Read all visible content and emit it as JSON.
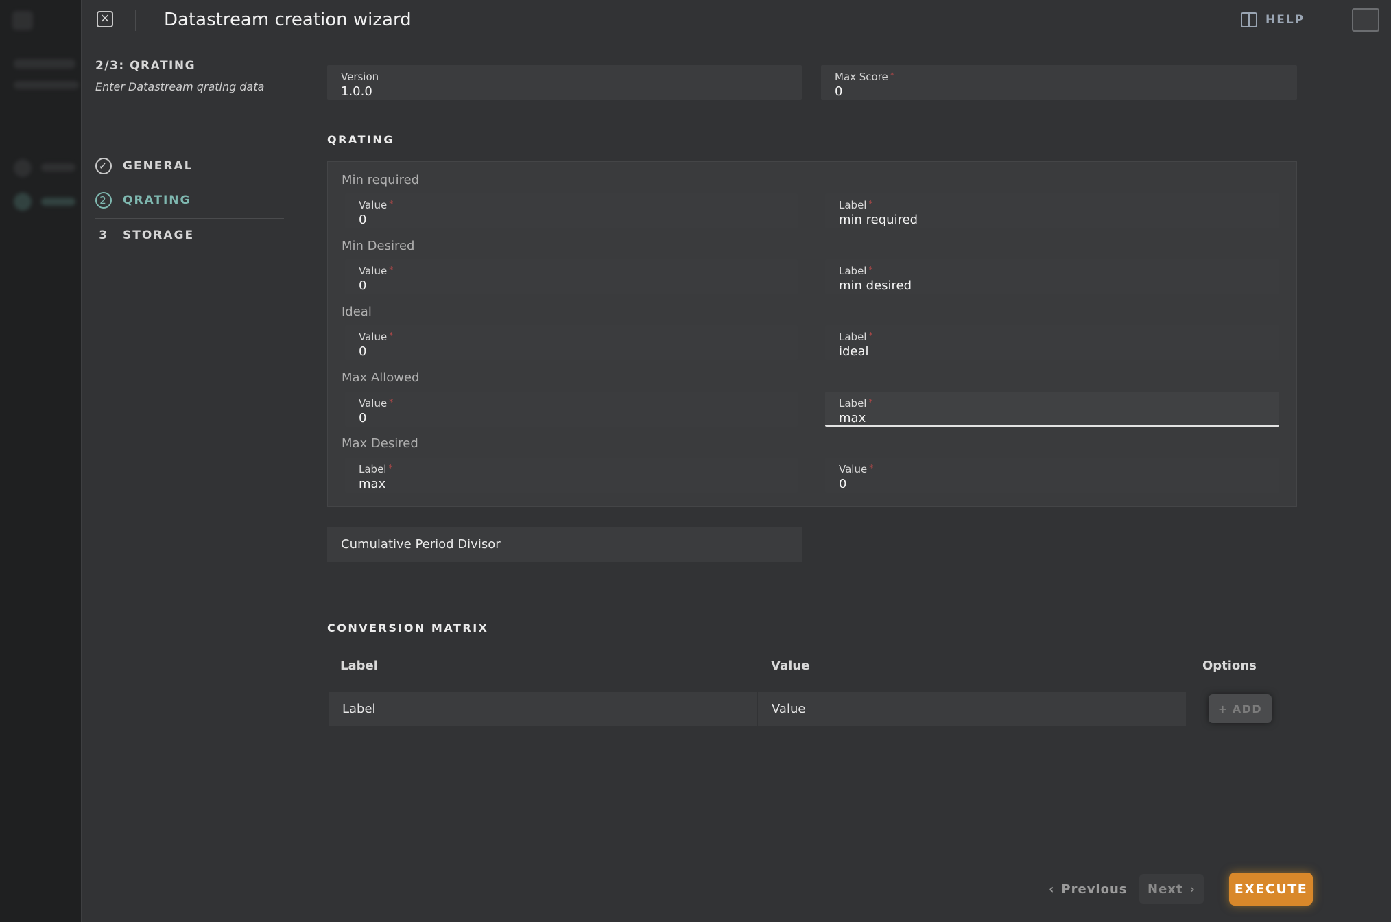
{
  "header": {
    "title": "Datastream creation wizard",
    "help_label": "HELP"
  },
  "sidebar": {
    "step_count": "2/3: QRATING",
    "step_description": "Enter Datastream qrating data",
    "steps": [
      {
        "marker": "✓",
        "label": "GENERAL",
        "status": "completed"
      },
      {
        "marker": "2",
        "label": "QRATING",
        "status": "active"
      },
      {
        "marker": "3",
        "label": "STORAGE",
        "status": "pending"
      }
    ]
  },
  "top_fields": {
    "version": {
      "label": "Version",
      "value": "1.0.0"
    },
    "max_score": {
      "label": "Max Score",
      "required": "*",
      "value": "0"
    }
  },
  "qrating": {
    "title": "QRATING",
    "groups": [
      {
        "name": "Min required",
        "left": {
          "label": "Value",
          "value": "0"
        },
        "right": {
          "label": "Label",
          "value": "min required"
        }
      },
      {
        "name": "Min Desired",
        "left": {
          "label": "Value",
          "value": "0"
        },
        "right": {
          "label": "Label",
          "value": "min desired"
        }
      },
      {
        "name": "Ideal",
        "left": {
          "label": "Value",
          "value": "0"
        },
        "right": {
          "label": "Label",
          "value": "ideal"
        }
      },
      {
        "name": "Max Allowed",
        "left": {
          "label": "Value",
          "value": "0"
        },
        "right": {
          "label": "Label",
          "value": "max"
        }
      },
      {
        "name": "Max Desired",
        "left": {
          "label": "Label",
          "value": "max"
        },
        "right": {
          "label": "Value",
          "value": "0"
        }
      }
    ],
    "required_mark": "*",
    "cumulative_period_divisor_placeholder": "Cumulative Period Divisor"
  },
  "conversion_matrix": {
    "title": "CONVERSION MATRIX",
    "columns": [
      "Label",
      "Value",
      "Options"
    ],
    "new_row": {
      "label_placeholder": "Label",
      "value_placeholder": "Value"
    },
    "add_label": "ADD",
    "add_icon": "+"
  },
  "footer": {
    "previous_label": "Previous",
    "next_label": "Next",
    "execute_label": "EXECUTE"
  },
  "colors": {
    "accent_teal": "#7fb8b0",
    "execute_orange": "#d9882a",
    "required_red": "#b04848"
  }
}
